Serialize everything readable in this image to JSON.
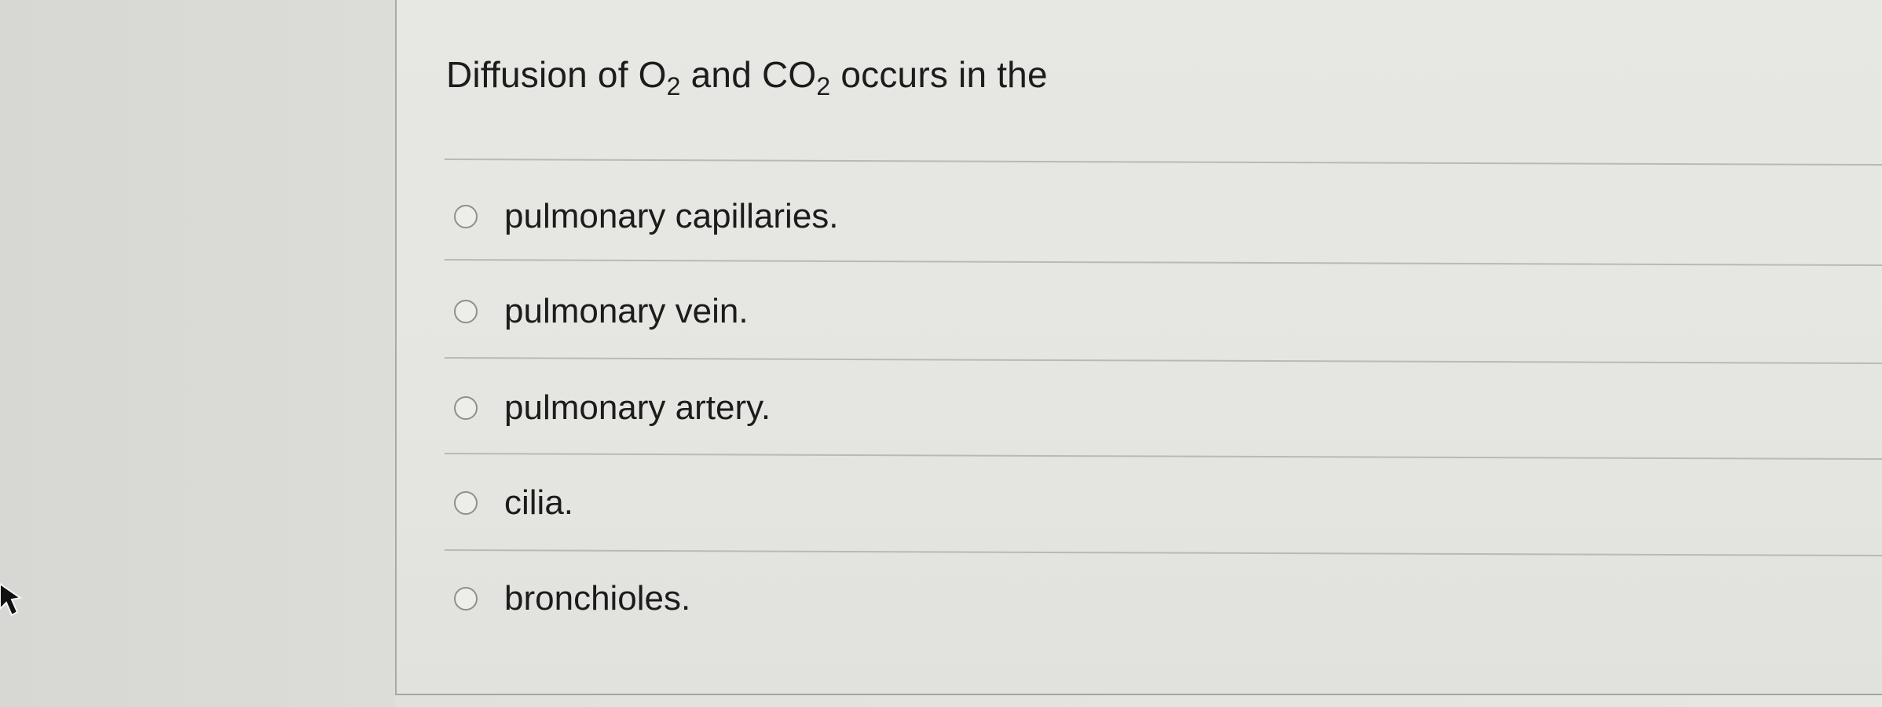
{
  "question": {
    "prefix": "Diffusion of O",
    "sub1": "2",
    "middle": " and CO",
    "sub2": "2",
    "suffix": " occurs in the"
  },
  "options": [
    {
      "label": "pulmonary capillaries.",
      "selected": false
    },
    {
      "label": "pulmonary vein.",
      "selected": false
    },
    {
      "label": "pulmonary artery.",
      "selected": false
    },
    {
      "label": "cilia.",
      "selected": false
    },
    {
      "label": "bronchioles.",
      "selected": false
    }
  ],
  "icons": {
    "pointer": "mouse-pointer-icon"
  },
  "colors": {
    "background": "#e4e4e0",
    "text": "#1c1c1c",
    "divider": "#b9b9b5",
    "radio_border": "#8f8f8c"
  }
}
